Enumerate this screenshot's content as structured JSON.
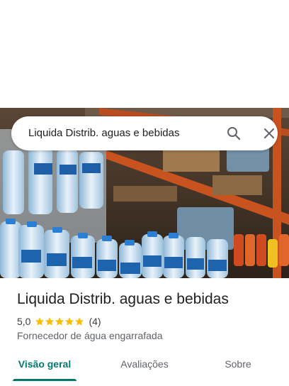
{
  "search": {
    "query": "Liquida Distrib. aguas e bebidas",
    "search_icon": "search-icon",
    "close_icon": "close-icon"
  },
  "place": {
    "name": "Liquida Distrib. aguas e bebidas",
    "rating": "5,0",
    "stars": 5,
    "review_count": "(4)",
    "category": "Fornecedor de água engarrafada"
  },
  "tabs": [
    {
      "label": "Visão geral",
      "active": true
    },
    {
      "label": "Avaliações",
      "active": false
    },
    {
      "label": "Sobre",
      "active": false
    }
  ],
  "colors": {
    "accent": "#01796f",
    "star": "#fbbc04"
  }
}
